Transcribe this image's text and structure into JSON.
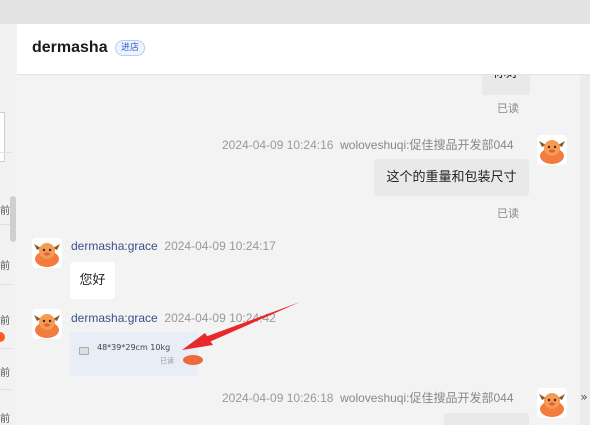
{
  "header": {
    "shop_name": "dermasha",
    "enter_label": "进店"
  },
  "left_list": {
    "truncated_labels": [
      "前",
      "前",
      "前",
      "前",
      "前"
    ]
  },
  "messages": [
    {
      "id": "m0",
      "direction": "out",
      "text": "你好",
      "status": "已读"
    },
    {
      "id": "m1",
      "direction": "out",
      "timestamp": "2024-04-09 10:24:16",
      "sender": "woloveshuqi:促佳搜品开发部044",
      "text": "这个的重量和包装尺寸",
      "status": "已读"
    },
    {
      "id": "m2",
      "direction": "in",
      "sender": "dermasha:grace",
      "timestamp": "2024-04-09 10:24:17",
      "text": "您好"
    },
    {
      "id": "m3",
      "direction": "in",
      "sender": "dermasha:grace",
      "timestamp": "2024-04-09 10:24:42",
      "card_text": "48*39*29cm  10kg",
      "card_status": "已读"
    },
    {
      "id": "m4",
      "direction": "out",
      "timestamp": "2024-04-09 10:26:18",
      "sender": "woloveshuqi:促佳搜品开发部044"
    }
  ],
  "edge_icon": "»",
  "colors": {
    "accent": "#2d5cc6",
    "annotation_arrow": "#e8292b",
    "unread_dot": "#ff5a1f"
  },
  "icons": [
    "avatar-mascot-icon",
    "image-placeholder-icon",
    "double-chevron-icon"
  ]
}
